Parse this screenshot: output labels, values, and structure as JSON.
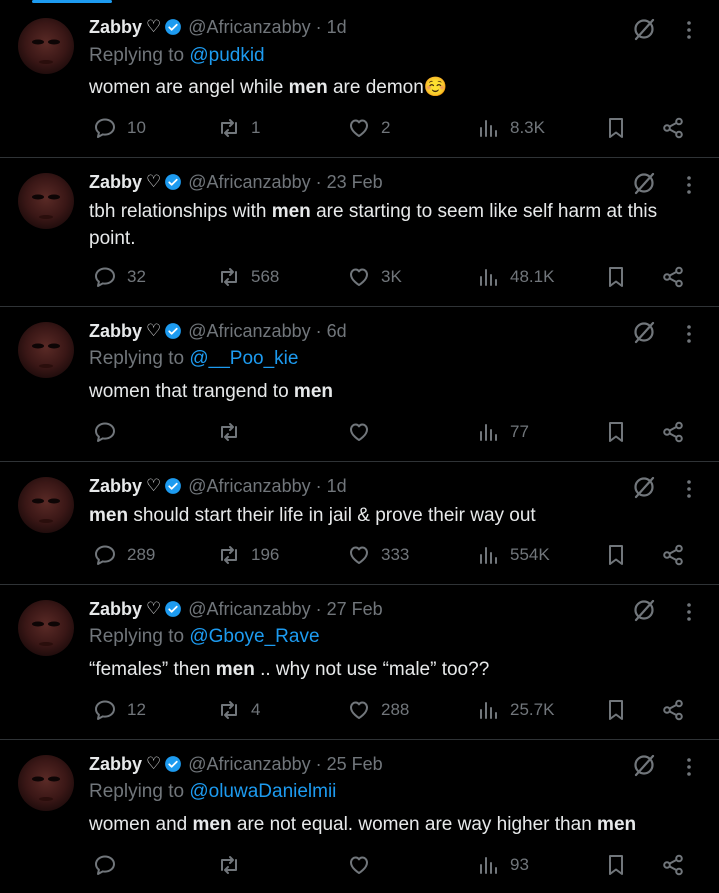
{
  "colors": {
    "background": "#000000",
    "text": "#e7e9ea",
    "muted": "#71767b",
    "link": "#1d9bf0",
    "divider": "#2f3336"
  },
  "tweets": [
    {
      "name": "Zabby",
      "name_symbol": "♡",
      "handle_time": "@Africanzabby · 1d",
      "reply_prefix": "Replying to",
      "reply_to": "@pudkid",
      "text_parts": [
        "women are angel while ",
        "men",
        " are demon☺️"
      ],
      "replies": "10",
      "reposts": "1",
      "likes": "2",
      "views": "8.3K"
    },
    {
      "name": "Zabby",
      "name_symbol": "♡",
      "handle_time": "@Africanzabby · 23 Feb",
      "reply_prefix": "",
      "reply_to": "",
      "text_parts": [
        "tbh relationships with ",
        "men",
        " are starting to seem like self harm at this point."
      ],
      "replies": "32",
      "reposts": "568",
      "likes": "3K",
      "views": "48.1K"
    },
    {
      "name": "Zabby",
      "name_symbol": "♡",
      "handle_time": "@Africanzabby · 6d",
      "reply_prefix": "Replying to",
      "reply_to": "@__Poo_kie",
      "text_parts": [
        "women that trangend to ",
        "men",
        ""
      ],
      "replies": "",
      "reposts": "",
      "likes": "",
      "views": "77"
    },
    {
      "name": "Zabby",
      "name_symbol": "♡",
      "handle_time": "@Africanzabby · 1d",
      "reply_prefix": "",
      "reply_to": "",
      "text_parts": [
        "",
        "men",
        " should start their life in jail & prove their way out"
      ],
      "replies": "289",
      "reposts": "196",
      "likes": "333",
      "views": "554K"
    },
    {
      "name": "Zabby",
      "name_symbol": "♡",
      "handle_time": "@Africanzabby · 27 Feb",
      "reply_prefix": "Replying to",
      "reply_to": "@Gboye_Rave",
      "text_parts": [
        "“females” then ",
        "men",
        " .. why not use “male” too??"
      ],
      "replies": "12",
      "reposts": "4",
      "likes": "288",
      "views": "25.7K"
    },
    {
      "name": "Zabby",
      "name_symbol": "♡",
      "handle_time": "@Africanzabby · 25 Feb",
      "reply_prefix": "Replying to",
      "reply_to": "@oluwaDanielmii",
      "text_parts": [
        "women and ",
        "men",
        " are not equal. women are way higher than ",
        "men"
      ],
      "replies": "",
      "reposts": "",
      "likes": "",
      "views": "93"
    }
  ]
}
